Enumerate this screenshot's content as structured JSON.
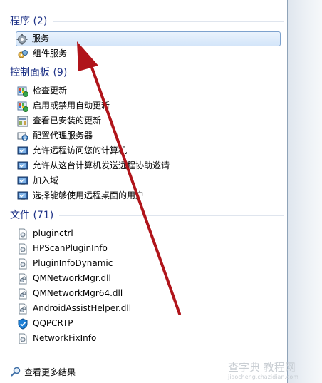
{
  "programs": {
    "header": "程序 (2)",
    "items": [
      {
        "label": "服务",
        "icon": "services-gear-icon",
        "selected": true
      },
      {
        "label": "组件服务",
        "icon": "component-services-icon",
        "selected": false
      }
    ]
  },
  "control_panel": {
    "header": "控制面板 (9)",
    "items": [
      {
        "label": "检查更新",
        "icon": "windows-update-icon"
      },
      {
        "label": "启用或禁用自动更新",
        "icon": "windows-update-icon"
      },
      {
        "label": "查看已安装的更新",
        "icon": "installed-updates-icon"
      },
      {
        "label": "配置代理服务器",
        "icon": "internet-options-icon"
      },
      {
        "label": "允许远程访问您的计算机",
        "icon": "system-monitor-icon"
      },
      {
        "label": "允许从这台计算机发送远程协助邀请",
        "icon": "system-monitor-icon"
      },
      {
        "label": "加入域",
        "icon": "system-monitor-icon"
      },
      {
        "label": "选择能够使用远程桌面的用户",
        "icon": "system-monitor-icon"
      }
    ]
  },
  "files": {
    "header": "文件 (71)",
    "items": [
      {
        "label": "pluginctrl",
        "icon": "config-file-icon"
      },
      {
        "label": "HPScanPluginInfo",
        "icon": "config-file-icon"
      },
      {
        "label": "PluginInfoDynamic",
        "icon": "config-file-icon"
      },
      {
        "label": "QMNetworkMgr.dll",
        "icon": "dll-file-icon"
      },
      {
        "label": "QMNetworkMgr64.dll",
        "icon": "dll-file-icon"
      },
      {
        "label": "AndroidAssistHelper.dll",
        "icon": "dll-file-icon"
      },
      {
        "label": "QQPCRTP",
        "icon": "qq-shield-icon"
      },
      {
        "label": "NetworkFixInfo",
        "icon": "config-file-icon"
      }
    ]
  },
  "footer": {
    "label": "查看更多结果",
    "icon": "search-icon"
  },
  "watermark": {
    "text": "查字典 教程网",
    "sub": "jiaocheng.chazidian.com"
  },
  "colors": {
    "header": "#1e3287",
    "selection_border": "#7da2ce",
    "arrow": "#b0141a"
  }
}
